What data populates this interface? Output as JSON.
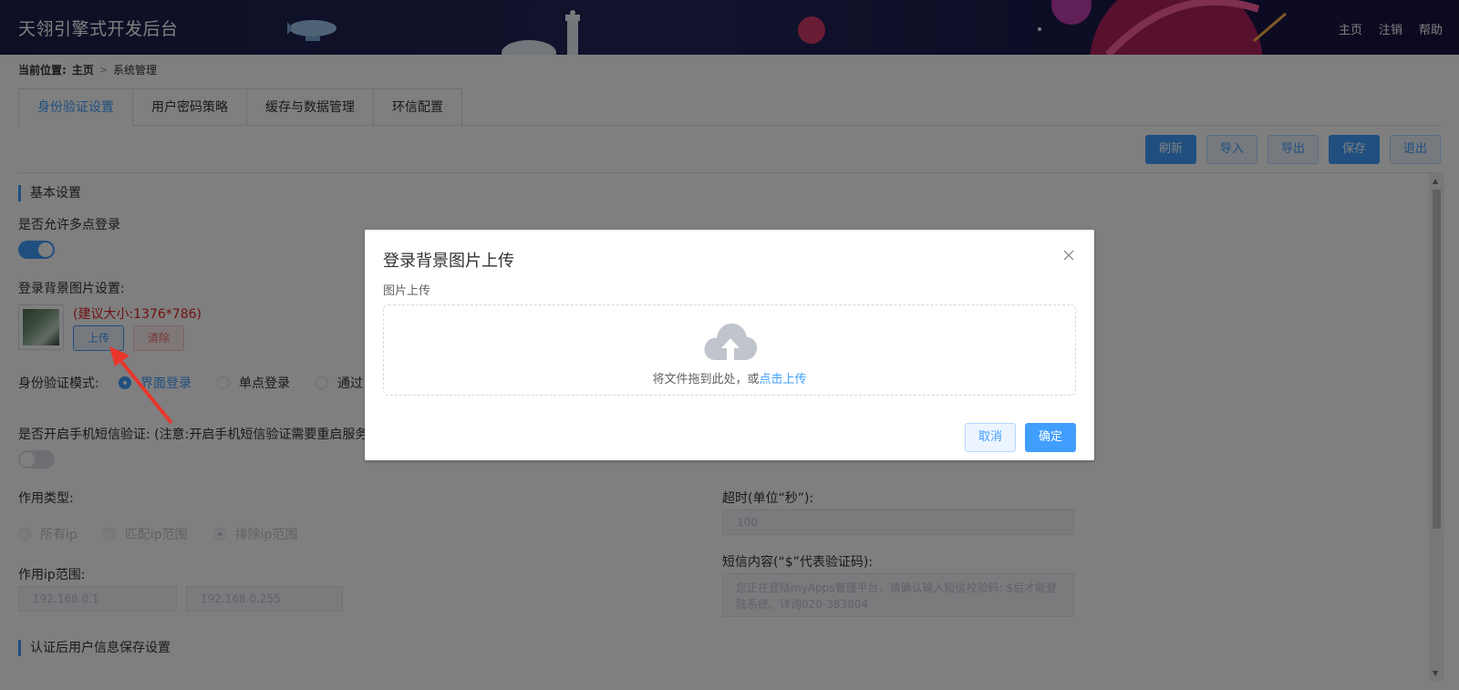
{
  "header": {
    "title": "天翎引擎式开发后台",
    "links": [
      "主页",
      "注销",
      "帮助"
    ]
  },
  "breadcrumb": {
    "prefix": "当前位置:",
    "home": "主页",
    "current": "系统管理"
  },
  "tabs": [
    {
      "label": "身份验证设置",
      "active": true
    },
    {
      "label": "用户密码策略",
      "active": false
    },
    {
      "label": "缓存与数据管理",
      "active": false
    },
    {
      "label": "环信配置",
      "active": false
    }
  ],
  "toolbar": {
    "refresh": "刷新",
    "import": "导入",
    "export": "导出",
    "save": "保存",
    "exit": "退出"
  },
  "form": {
    "basic_section": "基本设置",
    "multi_login_label": "是否允许多点登录",
    "multi_login_enabled": true,
    "bg_image_label": "登录背景图片设置:",
    "bg_image_hint": "(建议大小:1376*786)",
    "upload_btn": "上传",
    "clear_btn": "清除",
    "auth_mode_label": "身份验证模式:",
    "auth_modes": [
      {
        "label": "界面登录",
        "checked": true
      },
      {
        "label": "单点登录",
        "checked": false
      },
      {
        "label": "通过",
        "checked": false
      }
    ],
    "sms_label": "是否开启手机短信验证: (注意:开启手机短信验证需要重启服务",
    "sms_enabled": false,
    "scope_type_label": "作用类型:",
    "scope_types": [
      {
        "label": "所有ip",
        "checked": false
      },
      {
        "label": "匹配ip范围",
        "checked": false
      },
      {
        "label": "排除ip范围",
        "checked": true
      }
    ],
    "ip_range_label": "作用ip范围:",
    "ip_start": "192.168.0.1",
    "ip_end": "192.168.0.255",
    "timeout_label": "超时(单位“秒”):",
    "timeout_value": "100",
    "sms_content_label": "短信内容(“$”代表验证码):",
    "sms_content_value": "您正在登陆myApps管理平台，请确认输入短信校验码: $后才能登陆系统。详询020-383804",
    "user_info_section": "认证后用户信息保存设置"
  },
  "dialog": {
    "title": "登录背景图片上传",
    "field_label": "图片上传",
    "drop_text": "将文件拖到此处，或",
    "drop_link": "点击上传",
    "cancel": "取消",
    "confirm": "确定"
  },
  "colors": {
    "accent": "#409eff",
    "header_bg": "#1d1f4e",
    "hint_red": "#e02020"
  }
}
